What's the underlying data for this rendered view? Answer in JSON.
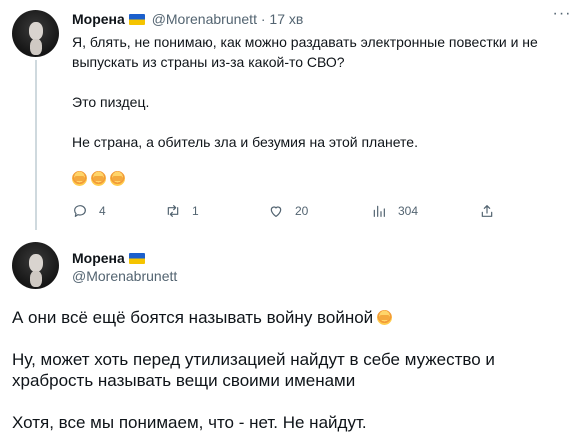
{
  "tweet1": {
    "author_name": "Морена",
    "author_handle": "@Morenabrunett",
    "separator": "·",
    "time": "17 хв",
    "paragraphs": [
      "Я, блять, не понимаю, как можно раздавать электронные повестки и не выпускать из страны из-за какой-то СВО?",
      "Это пиздец.",
      "Не страна, а обитель зла и безумия на этой планете."
    ],
    "emojis": [
      "facepalm-icon",
      "facepalm-icon",
      "facepalm-icon"
    ],
    "actions": {
      "replies": "4",
      "retweets": "1",
      "likes": "20",
      "views": "304"
    }
  },
  "tweet2": {
    "author_name": "Морена",
    "author_handle": "@Morenabrunett",
    "paragraphs": [
      "А они всё ещё боятся называть войну войной",
      "Ну, может хоть перед утилизацией найдут в себе мужество и храбрость называть вещи своими именами",
      "Хотя, все мы понимаем, что - нет. Не найдут."
    ]
  },
  "colors": {
    "text": "#0f1419",
    "secondary": "#536471",
    "thread_line": "#cfd9de",
    "flag_blue": "#1b5fcc",
    "flag_yellow": "#f5c400"
  }
}
